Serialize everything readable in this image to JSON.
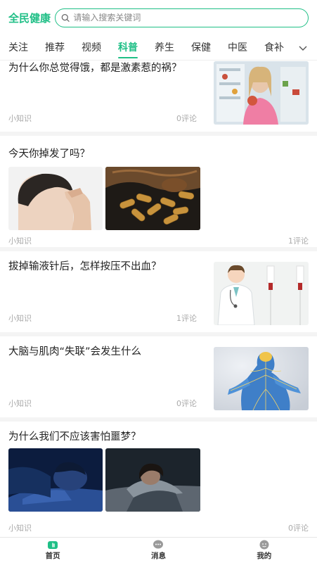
{
  "header": {
    "logo": "全民健康",
    "search_placeholder": "请输入搜索关键词"
  },
  "tabs": [
    {
      "label": "关注"
    },
    {
      "label": "推荐"
    },
    {
      "label": "视频"
    },
    {
      "label": "科普",
      "active": true
    },
    {
      "label": "养生"
    },
    {
      "label": "保健"
    },
    {
      "label": "中医"
    },
    {
      "label": "食补"
    }
  ],
  "feed": [
    {
      "title": "为什么你总觉得饿，都是激素惹的祸？",
      "tag": "小知识",
      "comments": "0评论"
    },
    {
      "title": "今天你掉发了吗？",
      "tag": "小知识",
      "comments": "1评论"
    },
    {
      "title": "拔掉输液针后，怎样按压不出血？",
      "tag": "小知识",
      "comments": "1评论"
    },
    {
      "title": "大脑与肌肉“失联”会发生什么",
      "tag": "小知识",
      "comments": "0评论"
    },
    {
      "title": "为什么我们不应该害怕噩梦？",
      "tag": "小知识",
      "comments": "0评论"
    }
  ],
  "bottom_nav": [
    {
      "label": "首页",
      "icon": "home-icon",
      "active": true
    },
    {
      "label": "消息",
      "icon": "message-icon"
    },
    {
      "label": "我的",
      "icon": "profile-icon"
    }
  ],
  "colors": {
    "accent": "#1fbf86"
  }
}
